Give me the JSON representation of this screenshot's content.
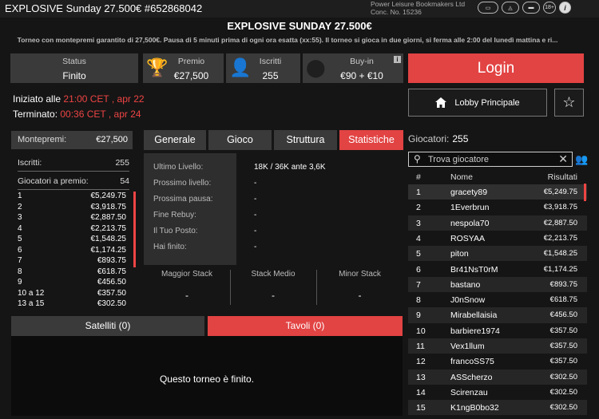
{
  "window": {
    "title": "EXPLOSIVE Sunday 27.500€ #652868042",
    "operator_line1": "Power Leisure Bookmakers Ltd",
    "operator_line2": "Conc. No. 15236",
    "icons": [
      "gambling-icon",
      "gaming-icon",
      "gaming-icon",
      "age-18-icon",
      "info-icon"
    ],
    "age_label": "18+",
    "info_label": "i"
  },
  "header": {
    "title": "EXPLOSIVE SUNDAY 27.500€",
    "subtitle": "Torneo con montepremi garantito di 27,500€. Pausa di 5 minuti prima di ogni ora esatta (xx:55). Il torneo si gioca in due giorni, si ferma alle 2:00 del lunedì mattina e ri..."
  },
  "stats": {
    "status_label": "Status",
    "status_value": "Finito",
    "prize_label": "Premio",
    "prize_value": "€27,500",
    "entrants_label": "Iscritti",
    "entrants_value": "255",
    "buyin_label": "Buy-in",
    "buyin_value": "€90 + €10"
  },
  "times": {
    "started_label": "Iniziato alle",
    "started_value": "21:00 CET , apr 22",
    "ended_label": "Terminato:",
    "ended_value": "00:36 CET , apr 24"
  },
  "actions": {
    "login_label": "Login",
    "lobby_label": "Lobby Principale"
  },
  "prize_panel": {
    "pool_label": "Montepremi:",
    "pool_value": "€27,500",
    "entrants_label": "Iscritti:",
    "entrants_value": "255",
    "itm_label": "Giocatori a premio:",
    "itm_value": "54",
    "payouts": [
      {
        "place": "1",
        "amount": "€5,249.75"
      },
      {
        "place": "2",
        "amount": "€3,918.75"
      },
      {
        "place": "3",
        "amount": "€2,887.50"
      },
      {
        "place": "4",
        "amount": "€2,213.75"
      },
      {
        "place": "5",
        "amount": "€1,548.25"
      },
      {
        "place": "6",
        "amount": "€1,174.25"
      },
      {
        "place": "7",
        "amount": "€893.75"
      },
      {
        "place": "8",
        "amount": "€618.75"
      },
      {
        "place": "9",
        "amount": "€456.50"
      },
      {
        "place": "10 a 12",
        "amount": "€357.50"
      },
      {
        "place": "13 a 15",
        "amount": "€302.50"
      }
    ]
  },
  "tabs": [
    {
      "label": "Generale"
    },
    {
      "label": "Gioco"
    },
    {
      "label": "Struttura"
    },
    {
      "label": "Statistiche"
    }
  ],
  "stats_detail": {
    "rows": [
      {
        "label": "Ultimo Livello:",
        "value": "18K / 36K ante 3,6K"
      },
      {
        "label": "Prossimo livello:",
        "value": "-"
      },
      {
        "label": "Prossima pausa:",
        "value": "-"
      },
      {
        "label": "Fine Rebuy:",
        "value": "-"
      },
      {
        "label": "Il Tuo Posto:",
        "value": "-"
      },
      {
        "label": "Hai finito:",
        "value": "-"
      }
    ],
    "stacks": [
      {
        "label": "Maggior Stack",
        "value": "-"
      },
      {
        "label": "Stack Medio",
        "value": "-"
      },
      {
        "label": "Minor Stack",
        "value": "-"
      }
    ]
  },
  "bottom_tabs": {
    "satellites_label": "Satelliti (0)",
    "tables_label": "Tavoli (0)",
    "message": "Questo torneo è finito."
  },
  "players": {
    "title": "Giocatori:",
    "count": "255",
    "search_placeholder": "Trova giocatore",
    "col_num": "#",
    "col_name": "Nome",
    "col_result": "Risultati",
    "rows": [
      {
        "n": "1",
        "name": "gracety89",
        "result": "€5,249.75"
      },
      {
        "n": "2",
        "name": "1Everbrun",
        "result": "€3,918.75"
      },
      {
        "n": "3",
        "name": "nespola70",
        "result": "€2,887.50"
      },
      {
        "n": "4",
        "name": "ROSYAA",
        "result": "€2,213.75"
      },
      {
        "n": "5",
        "name": "piton",
        "result": "€1,548.25"
      },
      {
        "n": "6",
        "name": "Br41NsT0rM",
        "result": "€1,174.25"
      },
      {
        "n": "7",
        "name": "bastano",
        "result": "€893.75"
      },
      {
        "n": "8",
        "name": "J0nSnow",
        "result": "€618.75"
      },
      {
        "n": "9",
        "name": "Mirabellaisia",
        "result": "€456.50"
      },
      {
        "n": "10",
        "name": "barbiere1974",
        "result": "€357.50"
      },
      {
        "n": "11",
        "name": "Vex1llum",
        "result": "€357.50"
      },
      {
        "n": "12",
        "name": "francoSS75",
        "result": "€357.50"
      },
      {
        "n": "13",
        "name": "ASScherzo",
        "result": "€302.50"
      },
      {
        "n": "14",
        "name": "Scirenzau",
        "result": "€302.50"
      },
      {
        "n": "15",
        "name": "K1ngB0bo32",
        "result": "€302.50"
      }
    ]
  }
}
